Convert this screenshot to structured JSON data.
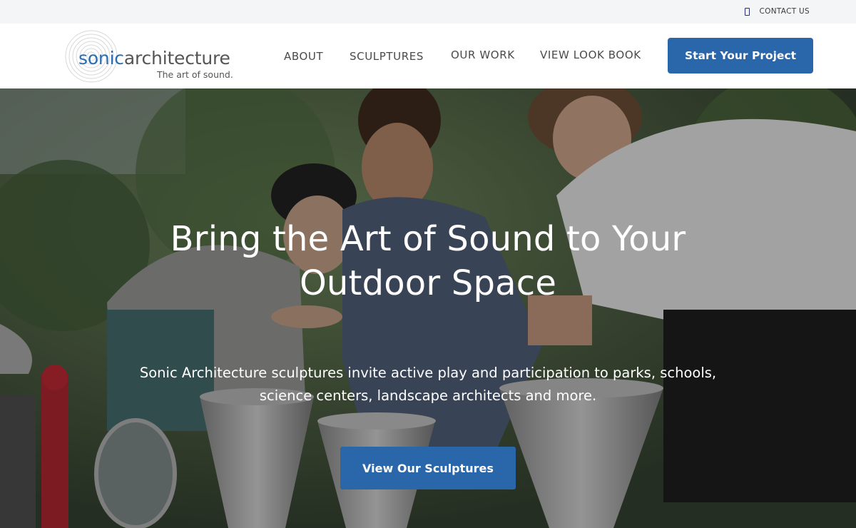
{
  "topbar": {
    "contact_label": "CONTACT US",
    "contact_icon": "phone-icon"
  },
  "brand": {
    "name_part1": "sonic",
    "name_part2": "architecture",
    "tagline": "The art of sound.",
    "brand_color": "#2a6db0"
  },
  "nav": {
    "items": [
      {
        "label": "ABOUT"
      },
      {
        "label": "SCULPTURES"
      },
      {
        "label": "OUR WORK"
      },
      {
        "label": "VIEW LOOK BOOK"
      }
    ],
    "cta_label": "Start Your Project"
  },
  "hero": {
    "title_line1": "Bring the Art of Sound to Your",
    "title_line2": "Outdoor Space",
    "subtitle_line1": "Sonic Architecture sculptures invite active play and participation to parks, schools,",
    "subtitle_line2": "science centers, landscape architects and more.",
    "button_label": "View Our Sculptures",
    "accent_color": "#2a66aa"
  }
}
